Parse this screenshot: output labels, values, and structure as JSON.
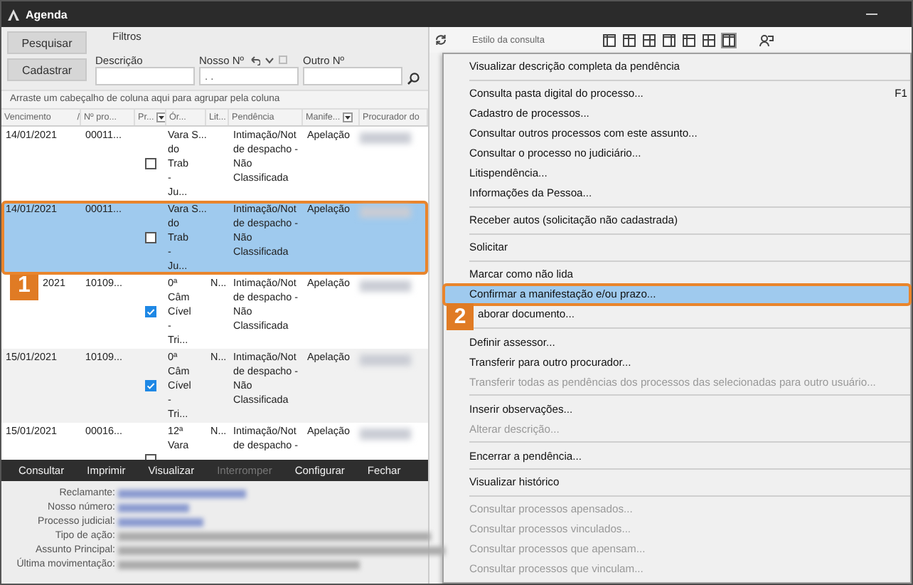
{
  "window": {
    "title": "Agenda"
  },
  "filters": {
    "buttons": [
      "Pesquisar",
      "Cadastrar"
    ],
    "group_label": "Filtros",
    "fields": [
      {
        "label": "Descrição"
      },
      {
        "label": "Nosso Nº",
        "value": ". .",
        "tools": true
      },
      {
        "label": "Outro Nº"
      }
    ]
  },
  "grid": {
    "group_hint": "Arraste um cabeçalho de coluna aqui para agrupar pela coluna",
    "columns": [
      {
        "label": "Vencimento",
        "sort_mark": "/"
      },
      {
        "label": "Nº pro..."
      },
      {
        "label": "Pr...",
        "filter": true
      },
      {
        "label": "Ór..."
      },
      {
        "label": "Lit..."
      },
      {
        "label": "Pendência"
      },
      {
        "label": "Manife...",
        "filter": true
      },
      {
        "label": "Procurador do"
      }
    ],
    "rows": [
      {
        "date": "14/01/2021",
        "number": "00011...",
        "checked": false,
        "organ": "Vara S...\ndo\nTrab\n-\nJu...",
        "pending": "Intimação/Not\nde despacho -\nNão\nClassificada",
        "manifestation": "Apelação",
        "selected": false
      },
      {
        "date": "14/01/2021",
        "number": "00011...",
        "checked": false,
        "organ": "Vara S...\ndo\nTrab\n-\nJu...",
        "pending": "Intimação/Not\nde despacho -\nNão\nClassificada",
        "manifestation": "Apelação",
        "selected": true,
        "callout": "1"
      },
      {
        "date": "2021",
        "number": "10109...",
        "checked": true,
        "organ": "0ª\nCâm\nCível\n-\nTri...",
        "lit": "N...",
        "pending": "Intimação/Not\nde despacho -\nNão\nClassificada",
        "manifestation": "Apelação",
        "selected": false
      },
      {
        "date": "15/01/2021",
        "number": "10109...",
        "checked": true,
        "organ": "0ª\nCâm\nCível\n-\nTri...",
        "lit": "N...",
        "pending": "Intimação/Not\nde despacho -\nNão\nClassificada",
        "manifestation": "Apelação",
        "selected": false
      },
      {
        "date": "15/01/2021",
        "number": "00016...",
        "checked": false,
        "organ": "12ª\nVara",
        "lit": "N...",
        "pending": "Intimação/Not\nde despacho -",
        "manifestation": "Apelação",
        "selected": false
      }
    ]
  },
  "actions": [
    {
      "label": "Consultar",
      "disabled": false
    },
    {
      "label": "Imprimir",
      "disabled": false
    },
    {
      "label": "Visualizar",
      "disabled": false
    },
    {
      "label": "Interromper",
      "disabled": true
    },
    {
      "label": "Configurar",
      "disabled": false
    },
    {
      "label": "Fechar",
      "disabled": false
    }
  ],
  "details": {
    "labels": [
      "Reclamante:",
      "Nosso número:",
      "Processo judicial:",
      "Tipo de ação:",
      "Assunto Principal:",
      "Última movimentação:"
    ]
  },
  "view_toolbar": {
    "label": "Estilo da consulta",
    "styles": [
      {
        "selected": false
      },
      {
        "selected": false
      },
      {
        "selected": false
      },
      {
        "selected": false
      },
      {
        "selected": false
      },
      {
        "selected": false
      },
      {
        "selected": true
      }
    ]
  },
  "menu": {
    "groups": [
      [
        {
          "label": "Visualizar descrição completa da pendência",
          "disabled": false,
          "selected": false
        }
      ],
      [
        {
          "label": "Consulta pasta digital do processo...",
          "shortcut": "F1",
          "disabled": false,
          "selected": false
        },
        {
          "label": "Cadastro de processos...",
          "disabled": false,
          "selected": false
        },
        {
          "label": "Consultar outros processos com este assunto...",
          "disabled": false,
          "selected": false
        },
        {
          "label": "Consultar o processo no judiciário...",
          "disabled": false,
          "selected": false
        },
        {
          "label": "Litispendência...",
          "disabled": false,
          "selected": false
        },
        {
          "label": "Informações da Pessoa...",
          "disabled": false,
          "selected": false
        }
      ],
      [
        {
          "label": "Receber autos (solicitação não cadastrada)",
          "disabled": false,
          "selected": false
        }
      ],
      [
        {
          "label": "Solicitar",
          "disabled": false,
          "selected": false
        }
      ],
      [
        {
          "label": "Marcar como não lida",
          "disabled": false,
          "selected": false
        },
        {
          "label": "Confirmar a manifestação e/ou prazo...",
          "disabled": false,
          "selected": true,
          "callout": "2"
        },
        {
          "label": "aborar documento...",
          "disabled": false,
          "selected": false
        }
      ],
      [
        {
          "label": "Definir assessor...",
          "disabled": false,
          "selected": false
        },
        {
          "label": "Transferir para outro procurador...",
          "disabled": false,
          "selected": false
        },
        {
          "label": "Transferir todas as pendências dos processos das selecionadas para outro usuário...",
          "disabled": true,
          "selected": false
        }
      ],
      [
        {
          "label": "Inserir observações...",
          "disabled": false,
          "selected": false
        },
        {
          "label": "Alterar descrição...",
          "disabled": true,
          "selected": false
        }
      ],
      [
        {
          "label": "Encerrar a pendência...",
          "disabled": false,
          "selected": false
        }
      ],
      [
        {
          "label": "Visualizar histórico",
          "disabled": false,
          "selected": false
        }
      ],
      [
        {
          "label": "Consultar processos apensados...",
          "disabled": true,
          "selected": false
        },
        {
          "label": "Consultar processos vinculados...",
          "disabled": true,
          "selected": false
        },
        {
          "label": "Consultar processos que apensam...",
          "disabled": true,
          "selected": false
        },
        {
          "label": "Consultar processos que vinculam...",
          "disabled": true,
          "selected": false
        }
      ]
    ]
  }
}
